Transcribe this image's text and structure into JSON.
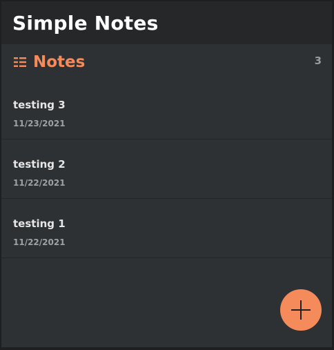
{
  "header": {
    "title": "Simple Notes"
  },
  "notes_section": {
    "label": "Notes",
    "count": "3",
    "icon": "list-icon"
  },
  "notes": [
    {
      "title": "testing 3",
      "date": "11/23/2021"
    },
    {
      "title": "testing 2",
      "date": "11/22/2021"
    },
    {
      "title": "testing 1",
      "date": "11/22/2021"
    }
  ],
  "fab": {
    "icon": "plus-icon"
  },
  "colors": {
    "accent": "#f58a5b",
    "background": "#2e3134",
    "header": "#262728"
  }
}
